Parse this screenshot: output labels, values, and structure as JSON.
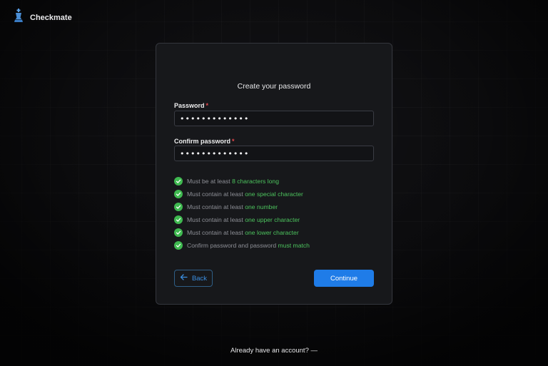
{
  "brand": {
    "name": "Checkmate"
  },
  "form": {
    "title": "Create your password",
    "password": {
      "label": "Password",
      "required_mark": "*",
      "value": "•••••••••••••"
    },
    "confirm_password": {
      "label": "Confirm password",
      "required_mark": "*",
      "value": "•••••••••••••"
    },
    "rules": [
      {
        "prefix": "Must be at least ",
        "highlight": "8 characters long",
        "met": true
      },
      {
        "prefix": "Must contain at least ",
        "highlight": "one special character",
        "met": true
      },
      {
        "prefix": "Must contain at least ",
        "highlight": "one number",
        "met": true
      },
      {
        "prefix": "Must contain at least ",
        "highlight": "one upper character",
        "met": true
      },
      {
        "prefix": "Must contain at least ",
        "highlight": "one lower character",
        "met": true
      },
      {
        "prefix": "Confirm password and password ",
        "highlight": "must match",
        "met": true
      }
    ],
    "back_label": "Back",
    "continue_label": "Continue"
  },
  "footer": {
    "text": "Already have an account? —"
  },
  "colors": {
    "accent": "#1f7ce8",
    "success": "#3fb950",
    "required": "#e5484d"
  },
  "icons": {
    "brand": "chess-king-icon",
    "back": "arrow-left-icon",
    "rule": "check-circle-icon"
  }
}
